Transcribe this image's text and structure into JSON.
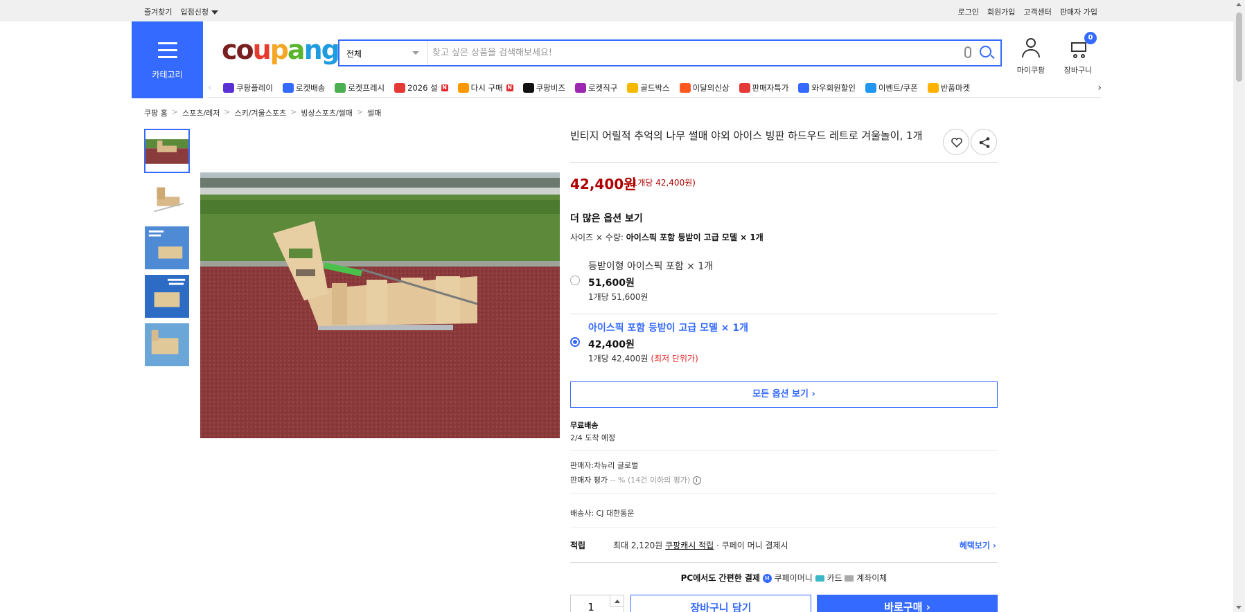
{
  "topbar": {
    "left": [
      "즐겨찾기",
      "입점신청"
    ],
    "right": [
      "로그인",
      "회원가입",
      "고객센터",
      "판매자 가입"
    ]
  },
  "header": {
    "category_label": "카테고리",
    "logo": "coupang",
    "search_category": "전체",
    "search_placeholder": "찾고 싶은 상품을 검색해보세요!",
    "mycoupang": "마이쿠팡",
    "cart": "장바구니",
    "cart_count": "0",
    "brand_color": "#346aff"
  },
  "nav": [
    {
      "label": "쿠팡플레이",
      "icon": "play-icon",
      "color": "#5a2fd3"
    },
    {
      "label": "로켓배송",
      "icon": "rocket-icon",
      "color": "#346aff"
    },
    {
      "label": "로켓프레시",
      "icon": "rocket-fresh-icon",
      "color": "#4caf50"
    },
    {
      "label": "2026 설",
      "icon": "gift-icon",
      "color": "#e53935",
      "badge": "N"
    },
    {
      "label": "다시 구매",
      "icon": "home-icon",
      "color": "#ff9800",
      "badge": "N"
    },
    {
      "label": "쿠팡비즈",
      "icon": "biz-icon",
      "color": "#111"
    },
    {
      "label": "로켓직구",
      "icon": "global-icon",
      "color": "#9c27b0"
    },
    {
      "label": "골드박스",
      "icon": "goldbox-icon",
      "color": "#f6b900"
    },
    {
      "label": "이달의신상",
      "icon": "new-icon",
      "color": "#ff5722"
    },
    {
      "label": "판매자특가",
      "icon": "percent-icon",
      "color": "#e53935"
    },
    {
      "label": "와우회원할인",
      "icon": "wow-icon",
      "color": "#346aff"
    },
    {
      "label": "이벤트/쿠폰",
      "icon": "coupon-icon",
      "color": "#2196f3"
    },
    {
      "label": "반품마켓",
      "icon": "return-market-icon",
      "color": "#ffb300"
    }
  ],
  "breadcrumb": [
    "쿠팡 홈",
    "스포츠/레저",
    "스키/겨울스포츠",
    "빙상스포츠/썰매",
    "썰매"
  ],
  "product": {
    "title": "빈티지 어릴적 추억의 나무 썰매 야외 아이스 빙판 하드우드 레트로 겨울놀이, 1개",
    "price": "42,400원",
    "unit_price": "(1개당 42,400원)",
    "more_options": "더 많은 옵션 보기",
    "option_selected_label": "사이즈 × 수량:",
    "option_selected_value": "아이스픽 포함 등받이 고급 모델 × 1개",
    "options": [
      {
        "name": "등받이형 아이스픽 포함 × 1개",
        "price": "51,600원",
        "per": "1개당 51,600원",
        "selected": false
      },
      {
        "name": "아이스픽 포함 등받이 고급 모델 × 1개",
        "price": "42,400원",
        "per": "1개당 42,400원",
        "tag": "(최저 단위가)",
        "selected": true
      }
    ],
    "all_options": "모든 옵션 보기 ›",
    "shipping_title": "무료배송",
    "shipping_date": "2/4 도착 예정",
    "seller": "판매자:차뉴리 글로벌",
    "seller_rate_label": "판매자 평가",
    "seller_rate_value": "-- % (14건 이하의 평가)",
    "carrier": "배송사: CJ 대한통운",
    "reward_label": "적립",
    "reward_text_1": "최대 2,120원",
    "reward_text_link": "쿠팡캐시 적립",
    "reward_text_2": "· 쿠페이 머니 결제시",
    "benefit": "혜택보기 ›",
    "pay_bold": "PC에서도 간편한 결제",
    "pay_methods": [
      "쿠페이머니",
      "카드",
      "계좌이체"
    ],
    "qty": "1",
    "cart_btn": "장바구니 담기",
    "buy_btn": "바로구매 ›"
  }
}
